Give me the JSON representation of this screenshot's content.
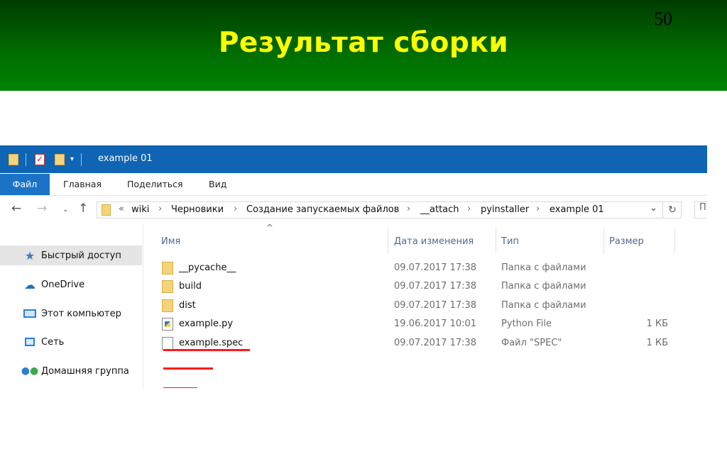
{
  "slide": {
    "title": "Результат сборки",
    "page_number": "50"
  },
  "window": {
    "title": "example 01",
    "ribbon_tabs": [
      "Файл",
      "Главная",
      "Поделиться",
      "Вид"
    ],
    "address": {
      "overflow": "«",
      "crumbs": [
        "wiki",
        "Черновики",
        "Создание запускаемых файлов",
        "__attach",
        "pyinstaller",
        "example 01"
      ],
      "search_placeholder": "П"
    },
    "nav_pane": [
      {
        "label": "Быстрый доступ",
        "icon": "star-icon"
      },
      {
        "label": "OneDrive",
        "icon": "cloud-icon"
      },
      {
        "label": "Этот компьютер",
        "icon": "computer-icon"
      },
      {
        "label": "Сеть",
        "icon": "network-icon"
      },
      {
        "label": "Домашняя группа",
        "icon": "homegroup-icon"
      }
    ],
    "columns": {
      "name": "Имя",
      "date": "Дата изменения",
      "type": "Тип",
      "size": "Размер"
    },
    "files": [
      {
        "name": "__pycache__",
        "date": "09.07.2017 17:38",
        "type": "Папка с файлами",
        "size": "",
        "icon": "folder-icon",
        "underlined": false
      },
      {
        "name": "build",
        "date": "09.07.2017 17:38",
        "type": "Папка с файлами",
        "size": "",
        "icon": "folder-icon",
        "underlined": true
      },
      {
        "name": "dist",
        "date": "09.07.2017 17:38",
        "type": "Папка с файлами",
        "size": "",
        "icon": "folder-icon",
        "underlined": true
      },
      {
        "name": "example.py",
        "date": "19.06.2017 10:01",
        "type": "Python File",
        "size": "1 КБ",
        "icon": "python-file-icon",
        "underlined": false
      },
      {
        "name": "example.spec",
        "date": "09.07.2017 17:38",
        "type": "Файл \"SPEC\"",
        "size": "1 КБ",
        "icon": "file-icon",
        "underlined": true
      }
    ],
    "colors": {
      "titlebar": "#0f64b4",
      "highlight": "#ff1a1a",
      "slide_title": "#ffff00",
      "header_green": "#006e00"
    }
  }
}
